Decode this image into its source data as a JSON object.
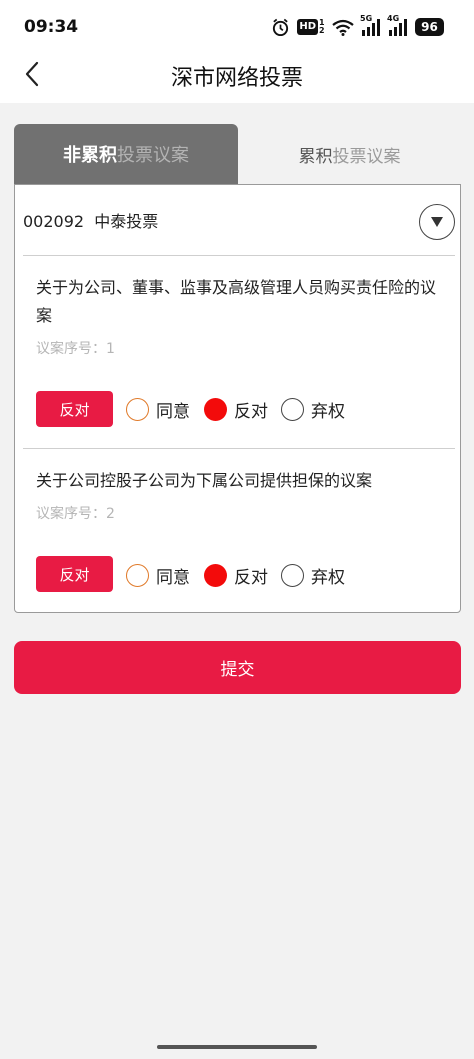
{
  "status_bar": {
    "time": "09:34",
    "hd_label": "HD",
    "hd_sub": "1 2",
    "net1_label": "5G",
    "net2_label": "4G",
    "battery": "96",
    "icons": [
      "alarm-icon",
      "wifi-icon",
      "signal-icon",
      "signal-icon",
      "battery-icon"
    ]
  },
  "header": {
    "title": "深市网络投票",
    "back_icon": "chevron-left-icon"
  },
  "tabs": {
    "active": {
      "strong": "非累积",
      "soft": "投票议案"
    },
    "inactive": {
      "strong": "累积",
      "soft": "投票议案"
    }
  },
  "stock": {
    "label": "002092  中泰投票",
    "dropdown_icon": "triangle-down-icon"
  },
  "motions": [
    {
      "title": "关于为公司、董事、监事及高级管理人员购买责任险的议案",
      "seq": "议案序号：1",
      "selected": "反对",
      "options": [
        "同意",
        "反对",
        "弃权"
      ]
    },
    {
      "title": "关于公司控股子公司为下属公司提供担保的议案",
      "seq": "议案序号：2",
      "selected": "反对",
      "options": [
        "同意",
        "反对",
        "弃权"
      ]
    }
  ],
  "submit_label": "提交",
  "colors": {
    "accent": "#e81b44",
    "radio_selected": "#f30b0b",
    "radio_agree": "#e07a2a",
    "tab_active_bg": "#717171"
  }
}
